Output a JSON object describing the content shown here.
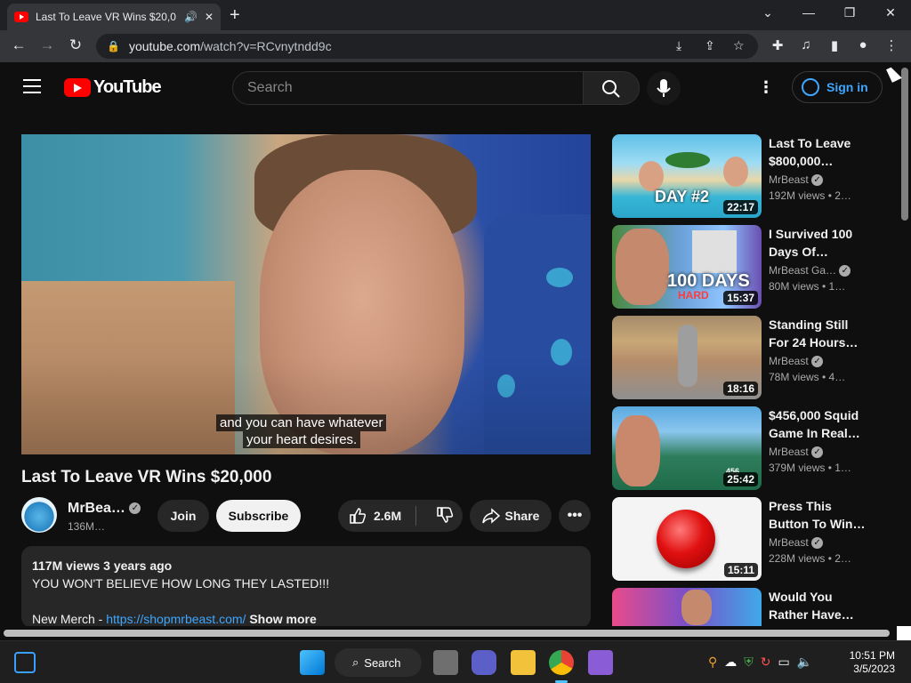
{
  "browser": {
    "tab_title": "Last To Leave VR Wins $20,0",
    "new_tab": "+",
    "url_host": "youtube.com",
    "url_path": "/watch?v=RCvnytndd9c"
  },
  "header": {
    "logo_text": "YouTube",
    "search_placeholder": "Search",
    "signin_label": "Sign in"
  },
  "player": {
    "caption_line1": "and you can have whatever",
    "caption_line2": "your heart desires."
  },
  "video": {
    "title": "Last To Leave VR Wins $20,000",
    "channel_name": "MrBea…",
    "channel_subs": "136M…",
    "join_label": "Join",
    "subscribe_label": "Subscribe",
    "likes": "2.6M",
    "share_label": "Share",
    "more_label": "•••"
  },
  "description": {
    "meta": "117M views  3 years ago",
    "line1": "YOU WON'T BELIEVE HOW LONG THEY LASTED!!!",
    "merch_prefix": "New Merch - ",
    "merch_link": "https://shopmrbeast.com/",
    "show_more": "Show more"
  },
  "recommendations": [
    {
      "title": "Last To Leave $800,000…",
      "channel": "MrBeast",
      "meta": "192M views  • 2…",
      "duration": "22:17",
      "thumb_text": "DAY #2"
    },
    {
      "title": "I Survived 100 Days Of…",
      "channel": "MrBeast Ga…",
      "meta": "80M views  • 1…",
      "duration": "15:37",
      "thumb_text": "100 DAYS",
      "thumb_text2": "HARD"
    },
    {
      "title": "Standing Still For 24 Hours…",
      "channel": "MrBeast",
      "meta": "78M views  • 4…",
      "duration": "18:16"
    },
    {
      "title": "$456,000 Squid Game In Real…",
      "channel": "MrBeast",
      "meta": "379M views  • 1…",
      "duration": "25:42",
      "thumb_text": "456"
    },
    {
      "title": "Press This Button To Win…",
      "channel": "MrBeast",
      "meta": "228M views  • 2…",
      "duration": "15:11"
    },
    {
      "title": "Would You Rather Have…",
      "channel": "",
      "meta": "",
      "duration": ""
    }
  ],
  "taskbar": {
    "search_label": "Search",
    "time": "10:51 PM",
    "date": "3/5/2023"
  }
}
